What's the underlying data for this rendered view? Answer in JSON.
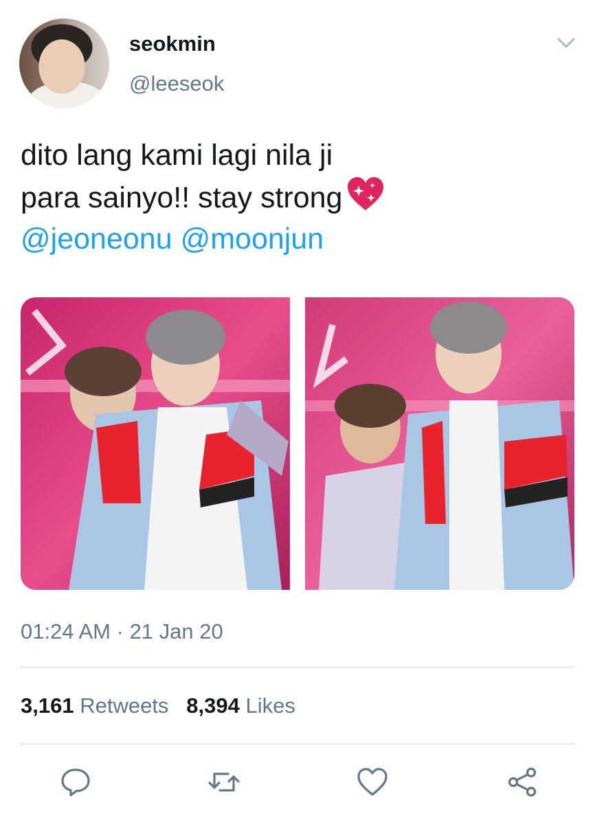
{
  "user": {
    "display_name": "seokmin",
    "handle": "@leeseok"
  },
  "tweet": {
    "text_line1": "dito lang kami lagi nila ji",
    "text_line2": "para sainyo!! stay strong",
    "emoji": "sparkling-heart",
    "mentions": [
      "@jeoneonu",
      "@moonjun"
    ]
  },
  "media": {
    "photo_count": 2
  },
  "meta": {
    "time": "01:24 AM",
    "separator": "·",
    "date": "21 Jan 20"
  },
  "stats": {
    "retweets_count": "3,161",
    "retweets_label": "Retweets",
    "likes_count": "8,394",
    "likes_label": "Likes"
  },
  "actions": [
    "reply-icon",
    "retweet-icon",
    "like-icon",
    "share-icon"
  ],
  "colors": {
    "text": "#14171a",
    "secondary": "#657786",
    "link": "#1da1f2",
    "divider": "#ccd6dd"
  }
}
